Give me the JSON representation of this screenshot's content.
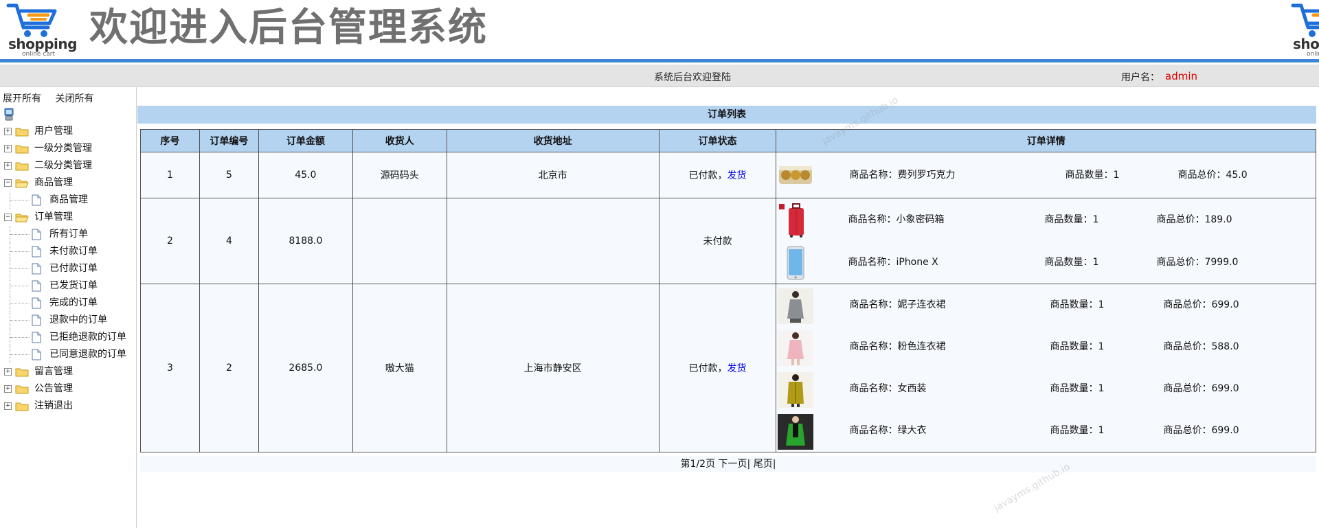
{
  "header": {
    "logo_text": "shopping",
    "logo_sub": "online cart",
    "title": "欢迎进入后台管理系统"
  },
  "status_bar": {
    "welcome": "系统后台欢迎登陆",
    "user_label": "用户名：",
    "user_name": "admin"
  },
  "sidebar": {
    "expand_all": "展开所有",
    "close_all": "关闭所有",
    "items": [
      {
        "label": "用户管理",
        "type": "folder"
      },
      {
        "label": "一级分类管理",
        "type": "folder"
      },
      {
        "label": "二级分类管理",
        "type": "folder"
      },
      {
        "label": "商品管理",
        "type": "folder",
        "open": true
      },
      {
        "label": "商品管理",
        "type": "doc"
      },
      {
        "label": "订单管理",
        "type": "folder",
        "open": true
      },
      {
        "label": "所有订单",
        "type": "doc"
      },
      {
        "label": "未付款订单",
        "type": "doc"
      },
      {
        "label": "已付款订单",
        "type": "doc"
      },
      {
        "label": "已发货订单",
        "type": "doc"
      },
      {
        "label": "完成的订单",
        "type": "doc"
      },
      {
        "label": "退款中的订单",
        "type": "doc"
      },
      {
        "label": "已拒绝退款的订单",
        "type": "doc"
      },
      {
        "label": "已同意退款的订单",
        "type": "doc"
      },
      {
        "label": "留言管理",
        "type": "folder"
      },
      {
        "label": "公告管理",
        "type": "folder"
      },
      {
        "label": "注销退出",
        "type": "folder"
      }
    ]
  },
  "order_list": {
    "title": "订单列表",
    "columns": [
      "序号",
      "订单编号",
      "订单金额",
      "收货人",
      "收货地址",
      "订单状态",
      "订单详情"
    ],
    "name_prefix": "商品名称：",
    "qty_prefix": "商品数量：",
    "total_prefix": "商品总价：",
    "rows": [
      {
        "seq": "1",
        "order_no": "5",
        "amount": "45.0",
        "receiver": "源码码头",
        "address": "北京市",
        "status": "已付款，",
        "action": "发货",
        "items": [
          {
            "name": "费列罗巧克力",
            "qty": "1",
            "total": "45.0",
            "img": "chocolate"
          }
        ]
      },
      {
        "seq": "2",
        "order_no": "4",
        "amount": "8188.0",
        "receiver": "",
        "address": "",
        "status": "未付款",
        "action": "",
        "items": [
          {
            "name": "小象密码箱",
            "qty": "1",
            "total": "189.0",
            "img": "suitcase"
          },
          {
            "name": "iPhone X",
            "qty": "1",
            "total": "7999.0",
            "img": "phone"
          }
        ]
      },
      {
        "seq": "3",
        "order_no": "2",
        "amount": "2685.0",
        "receiver": "嗷大猫",
        "address": "上海市静安区",
        "status": "已付款，",
        "action": "发货",
        "items": [
          {
            "name": "妮子连衣裙",
            "qty": "1",
            "total": "699.0",
            "img": "dress-grey"
          },
          {
            "name": "粉色连衣裙",
            "qty": "1",
            "total": "588.0",
            "img": "dress-pink"
          },
          {
            "name": "女西装",
            "qty": "1",
            "total": "699.0",
            "img": "suit-yellow"
          },
          {
            "name": "绿大衣",
            "qty": "1",
            "total": "699.0",
            "img": "coat-green"
          }
        ]
      }
    ]
  },
  "pager": {
    "page_info": "第1/2页",
    "next": "下一页",
    "sep1": "|",
    "last": "尾页",
    "sep2": "|"
  },
  "watermark": "javayms.github.io",
  "colors": {
    "header_line": "#3d87d6",
    "table_header": "#b4d3f1",
    "user_name": "#e00000",
    "link": "#0000ee"
  }
}
